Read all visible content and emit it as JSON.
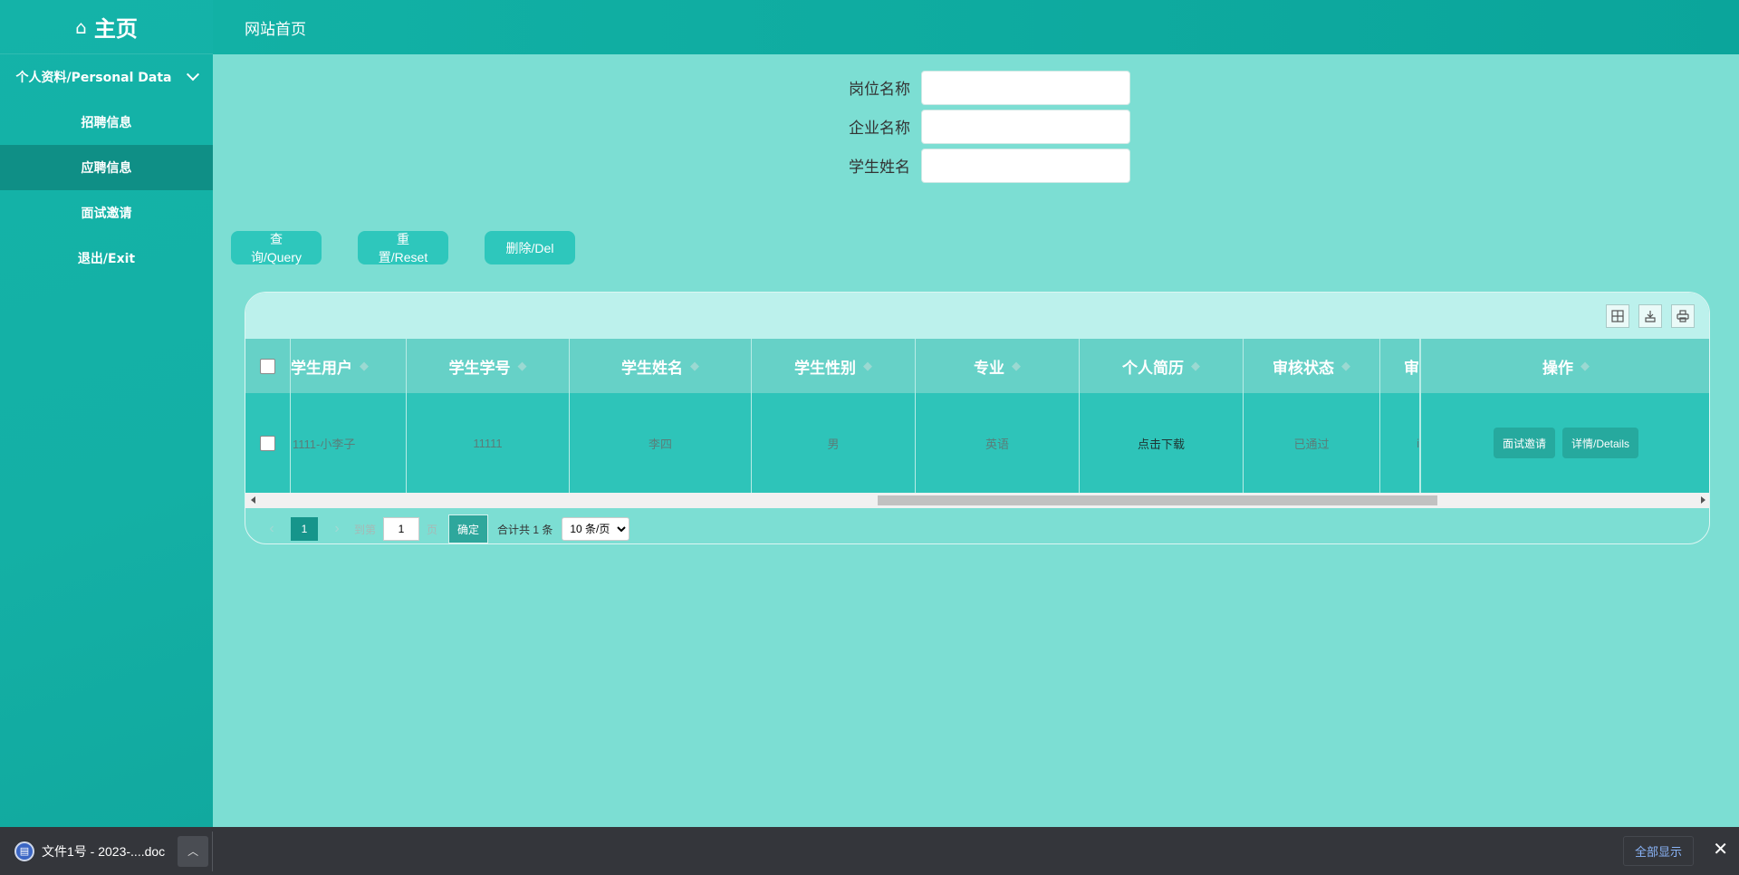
{
  "sidebar": {
    "brand": "主页",
    "group": "个人资料/Personal Data",
    "items": [
      {
        "label": "招聘信息"
      },
      {
        "label": "应聘信息"
      },
      {
        "label": "面试邀请"
      },
      {
        "label": "退出/Exit"
      }
    ]
  },
  "header": {
    "title": "网站首页"
  },
  "search": {
    "fields": [
      {
        "label": "岗位名称",
        "value": ""
      },
      {
        "label": "企业名称",
        "value": ""
      },
      {
        "label": "学生姓名",
        "value": ""
      }
    ]
  },
  "actions": {
    "query": "查询/Query",
    "reset": "重置/Reset",
    "delete": "删除/Del"
  },
  "table": {
    "columns": [
      "学生用户",
      "学生学号",
      "学生姓名",
      "学生性别",
      "专业",
      "个人简历",
      "审核状态",
      "审",
      "操作"
    ],
    "rows": [
      {
        "user": "1111-小李子",
        "student_no": "11111",
        "name": "李四",
        "gender": "男",
        "major": "英语",
        "resume": "点击下载",
        "status": "已通过",
        "clipped": "i",
        "op_invite": "面试邀请",
        "op_details": "详情/Details"
      }
    ]
  },
  "pagination": {
    "current": "1",
    "goto_prefix": "到第",
    "goto_value": "1",
    "goto_suffix": "页",
    "confirm": "确定",
    "total": "合计共 1 条",
    "page_size": "10 条/页"
  },
  "download_bar": {
    "file": "文件1号 - 2023-....doc",
    "show_all": "全部显示"
  }
}
